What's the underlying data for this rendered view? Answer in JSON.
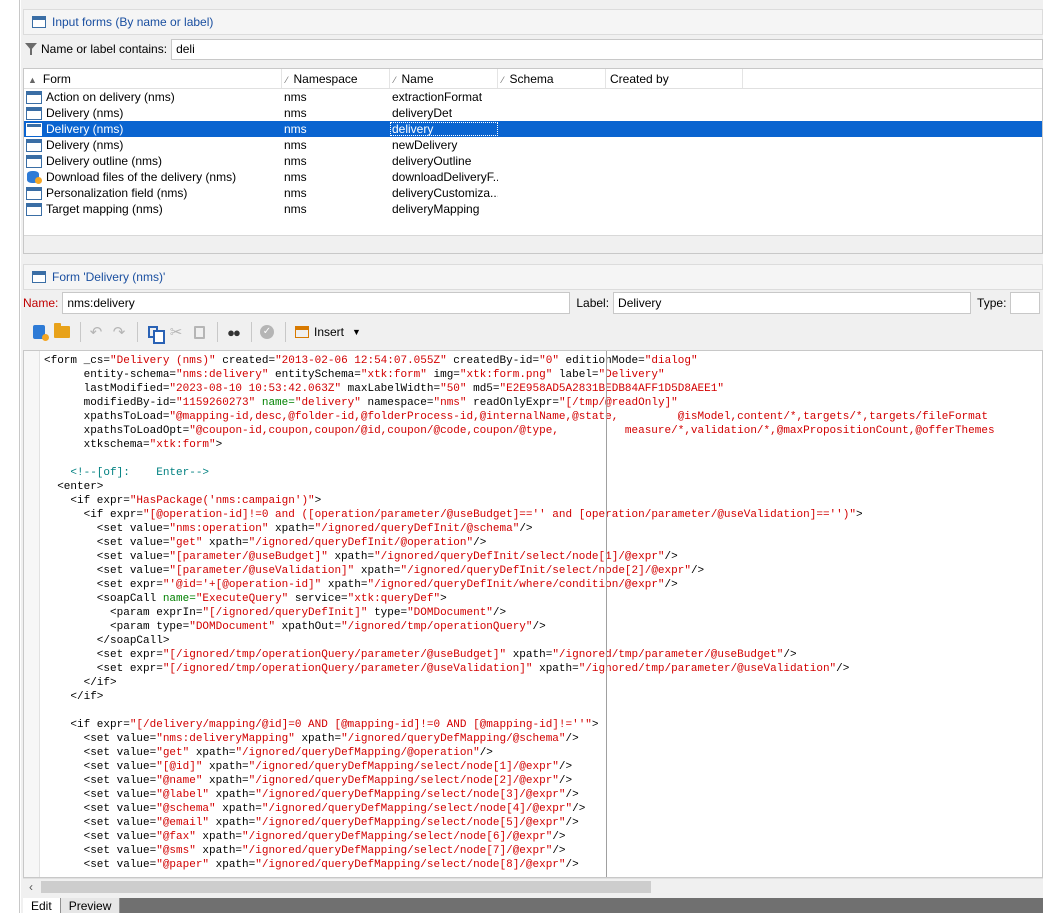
{
  "forms_panel": {
    "title": "Input forms (By name or label)",
    "filter_label": "Name or label contains:",
    "filter_value": "deli"
  },
  "list": {
    "columns": [
      "Form",
      "Namespace",
      "Name",
      "Schema",
      "Created by"
    ],
    "rows": [
      {
        "form": "Action on delivery (nms)",
        "namespace": "nms",
        "name": "extractionFormat",
        "icon": "form-icon"
      },
      {
        "form": "Delivery (nms)",
        "namespace": "nms",
        "name": "deliveryDet",
        "icon": "form-icon"
      },
      {
        "form": "Delivery (nms)",
        "namespace": "nms",
        "name": "delivery",
        "icon": "form-icon",
        "selected": true
      },
      {
        "form": "Delivery (nms)",
        "namespace": "nms",
        "name": "newDelivery",
        "icon": "form-icon"
      },
      {
        "form": "Delivery outline (nms)",
        "namespace": "nms",
        "name": "deliveryOutline",
        "icon": "form-icon"
      },
      {
        "form": "Download files of the delivery (nms)",
        "namespace": "nms",
        "name": "downloadDeliveryF...",
        "icon": "database-icon"
      },
      {
        "form": "Personalization field (nms)",
        "namespace": "nms",
        "name": "deliveryCustomiza...",
        "icon": "form-icon"
      },
      {
        "form": "Target mapping (nms)",
        "namespace": "nms",
        "name": "deliveryMapping",
        "icon": "form-icon"
      }
    ]
  },
  "detail": {
    "title": "Form 'Delivery (nms)'",
    "name_label": "Name:",
    "name_value": "nms:delivery",
    "label_label": "Label:",
    "label_value": "Delivery",
    "type_label": "Type:",
    "type_value": ""
  },
  "toolbar": {
    "insert_label": "Insert"
  },
  "code_lines": [
    [
      [
        "k",
        "<form _cs="
      ],
      [
        "r",
        "\"Delivery (nms)\""
      ],
      [
        "k",
        " created="
      ],
      [
        "r",
        "\"2013-02-06 12:54:07.055Z\""
      ],
      [
        "k",
        " createdBy-id="
      ],
      [
        "r",
        "\"0\""
      ],
      [
        "k",
        " editionMode="
      ],
      [
        "r",
        "\"dialog\""
      ]
    ],
    [
      [
        "k",
        "      entity-schema="
      ],
      [
        "r",
        "\"nms:delivery\""
      ],
      [
        "k",
        " entitySchema="
      ],
      [
        "r",
        "\"xtk:form\""
      ],
      [
        "k",
        " img="
      ],
      [
        "r",
        "\"xtk:form.png\""
      ],
      [
        "k",
        " label="
      ],
      [
        "r",
        "\"Delivery\""
      ]
    ],
    [
      [
        "k",
        "      lastModified="
      ],
      [
        "r",
        "\"2023-08-10 10:53:42.063Z\""
      ],
      [
        "k",
        " maxLabelWidth="
      ],
      [
        "r",
        "\"50\""
      ],
      [
        "k",
        " md5="
      ],
      [
        "r",
        "\"E2E958AD5A2831BEDB84AFF1D5D8AEE1\""
      ]
    ],
    [
      [
        "k",
        "      modifiedBy-id="
      ],
      [
        "r",
        "\"1159260273\""
      ],
      [
        "g",
        " name="
      ],
      [
        "r",
        "\"delivery\""
      ],
      [
        "k",
        " namespace="
      ],
      [
        "r",
        "\"nms\""
      ],
      [
        "k",
        " readOnlyExpr="
      ],
      [
        "r",
        "\"[/tmp/@readOnly]\""
      ]
    ],
    [
      [
        "k",
        "      xpathsToLoad="
      ],
      [
        "r",
        "\"@mapping-id,desc,@folder-id,@folderProcess-id,@internalName,@state,         @isModel,content/*,targets/*,targets/fileFormat"
      ]
    ],
    [
      [
        "k",
        "      xpathsToLoadOpt="
      ],
      [
        "r",
        "\"@coupon-id,coupon,coupon/@id,coupon/@code,coupon/@type,          measure/*,validation/*,@maxPropositionCount,@offerThemes"
      ]
    ],
    [
      [
        "k",
        "      xtkschema="
      ],
      [
        "r",
        "\"xtk:form\""
      ],
      [
        "k",
        ">"
      ]
    ],
    [
      [
        "k",
        ""
      ]
    ],
    [
      [
        "c",
        "    <!--[of]:    Enter-->"
      ]
    ],
    [
      [
        "k",
        "  <enter>"
      ]
    ],
    [
      [
        "k",
        "    <if expr="
      ],
      [
        "r",
        "\"HasPackage('nms:campaign')\""
      ],
      [
        "k",
        ">"
      ]
    ],
    [
      [
        "k",
        "      <if expr="
      ],
      [
        "r",
        "\"[@operation-id]!=0 and ([operation/parameter/@useBudget]=='' and [operation/parameter/@useValidation]=='')\""
      ],
      [
        "k",
        ">"
      ]
    ],
    [
      [
        "k",
        "        <set value="
      ],
      [
        "r",
        "\"nms:operation\""
      ],
      [
        "k",
        " xpath="
      ],
      [
        "r",
        "\"/ignored/queryDefInit/@schema\""
      ],
      [
        "k",
        "/>"
      ]
    ],
    [
      [
        "k",
        "        <set value="
      ],
      [
        "r",
        "\"get\""
      ],
      [
        "k",
        " xpath="
      ],
      [
        "r",
        "\"/ignored/queryDefInit/@operation\""
      ],
      [
        "k",
        "/>"
      ]
    ],
    [
      [
        "k",
        "        <set value="
      ],
      [
        "r",
        "\"[parameter/@useBudget]\""
      ],
      [
        "k",
        " xpath="
      ],
      [
        "r",
        "\"/ignored/queryDefInit/select/node[1]/@expr\""
      ],
      [
        "k",
        "/>"
      ]
    ],
    [
      [
        "k",
        "        <set value="
      ],
      [
        "r",
        "\"[parameter/@useValidation]\""
      ],
      [
        "k",
        " xpath="
      ],
      [
        "r",
        "\"/ignored/queryDefInit/select/node[2]/@expr\""
      ],
      [
        "k",
        "/>"
      ]
    ],
    [
      [
        "k",
        "        <set expr="
      ],
      [
        "r",
        "\"'@id='+[@operation-id]\""
      ],
      [
        "k",
        " xpath="
      ],
      [
        "r",
        "\"/ignored/queryDefInit/where/condition/@expr\""
      ],
      [
        "k",
        "/>"
      ]
    ],
    [
      [
        "k",
        "        <soapCall"
      ],
      [
        "g",
        " name="
      ],
      [
        "r",
        "\"ExecuteQuery\""
      ],
      [
        "k",
        " service="
      ],
      [
        "r",
        "\"xtk:queryDef\""
      ],
      [
        "k",
        ">"
      ]
    ],
    [
      [
        "k",
        "          <param exprIn="
      ],
      [
        "r",
        "\"[/ignored/queryDefInit]\""
      ],
      [
        "k",
        " type="
      ],
      [
        "r",
        "\"DOMDocument\""
      ],
      [
        "k",
        "/>"
      ]
    ],
    [
      [
        "k",
        "          <param type="
      ],
      [
        "r",
        "\"DOMDocument\""
      ],
      [
        "k",
        " xpathOut="
      ],
      [
        "r",
        "\"/ignored/tmp/operationQuery\""
      ],
      [
        "k",
        "/>"
      ]
    ],
    [
      [
        "k",
        "        </soapCall>"
      ]
    ],
    [
      [
        "k",
        "        <set expr="
      ],
      [
        "r",
        "\"[/ignored/tmp/operationQuery/parameter/@useBudget]\""
      ],
      [
        "k",
        " xpath="
      ],
      [
        "r",
        "\"/ignored/tmp/parameter/@useBudget\""
      ],
      [
        "k",
        "/>"
      ]
    ],
    [
      [
        "k",
        "        <set expr="
      ],
      [
        "r",
        "\"[/ignored/tmp/operationQuery/parameter/@useValidation]\""
      ],
      [
        "k",
        " xpath="
      ],
      [
        "r",
        "\"/ignored/tmp/parameter/@useValidation\""
      ],
      [
        "k",
        "/>"
      ]
    ],
    [
      [
        "k",
        "      </if>"
      ]
    ],
    [
      [
        "k",
        "    </if>"
      ]
    ],
    [
      [
        "k",
        ""
      ]
    ],
    [
      [
        "k",
        "    <if expr="
      ],
      [
        "r",
        "\"[/delivery/mapping/@id]=0 AND [@mapping-id]!=0 AND [@mapping-id]!=''\""
      ],
      [
        "k",
        ">"
      ]
    ],
    [
      [
        "k",
        "      <set value="
      ],
      [
        "r",
        "\"nms:deliveryMapping\""
      ],
      [
        "k",
        " xpath="
      ],
      [
        "r",
        "\"/ignored/queryDefMapping/@schema\""
      ],
      [
        "k",
        "/>"
      ]
    ],
    [
      [
        "k",
        "      <set value="
      ],
      [
        "r",
        "\"get\""
      ],
      [
        "k",
        " xpath="
      ],
      [
        "r",
        "\"/ignored/queryDefMapping/@operation\""
      ],
      [
        "k",
        "/>"
      ]
    ],
    [
      [
        "k",
        "      <set value="
      ],
      [
        "r",
        "\"[@id]\""
      ],
      [
        "k",
        " xpath="
      ],
      [
        "r",
        "\"/ignored/queryDefMapping/select/node[1]/@expr\""
      ],
      [
        "k",
        "/>"
      ]
    ],
    [
      [
        "k",
        "      <set value="
      ],
      [
        "r",
        "\"@name\""
      ],
      [
        "k",
        " xpath="
      ],
      [
        "r",
        "\"/ignored/queryDefMapping/select/node[2]/@expr\""
      ],
      [
        "k",
        "/>"
      ]
    ],
    [
      [
        "k",
        "      <set value="
      ],
      [
        "r",
        "\"@label\""
      ],
      [
        "k",
        " xpath="
      ],
      [
        "r",
        "\"/ignored/queryDefMapping/select/node[3]/@expr\""
      ],
      [
        "k",
        "/>"
      ]
    ],
    [
      [
        "k",
        "      <set value="
      ],
      [
        "r",
        "\"@schema\""
      ],
      [
        "k",
        " xpath="
      ],
      [
        "r",
        "\"/ignored/queryDefMapping/select/node[4]/@expr\""
      ],
      [
        "k",
        "/>"
      ]
    ],
    [
      [
        "k",
        "      <set value="
      ],
      [
        "r",
        "\"@email\""
      ],
      [
        "k",
        " xpath="
      ],
      [
        "r",
        "\"/ignored/queryDefMapping/select/node[5]/@expr\""
      ],
      [
        "k",
        "/>"
      ]
    ],
    [
      [
        "k",
        "      <set value="
      ],
      [
        "r",
        "\"@fax\""
      ],
      [
        "k",
        " xpath="
      ],
      [
        "r",
        "\"/ignored/queryDefMapping/select/node[6]/@expr\""
      ],
      [
        "k",
        "/>"
      ]
    ],
    [
      [
        "k",
        "      <set value="
      ],
      [
        "r",
        "\"@sms\""
      ],
      [
        "k",
        " xpath="
      ],
      [
        "r",
        "\"/ignored/queryDefMapping/select/node[7]/@expr\""
      ],
      [
        "k",
        "/>"
      ]
    ],
    [
      [
        "k",
        "      <set value="
      ],
      [
        "r",
        "\"@paper\""
      ],
      [
        "k",
        " xpath="
      ],
      [
        "r",
        "\"/ignored/queryDefMapping/select/node[8]/@expr\""
      ],
      [
        "k",
        "/>"
      ]
    ]
  ],
  "tabs": [
    "Edit",
    "Preview"
  ]
}
